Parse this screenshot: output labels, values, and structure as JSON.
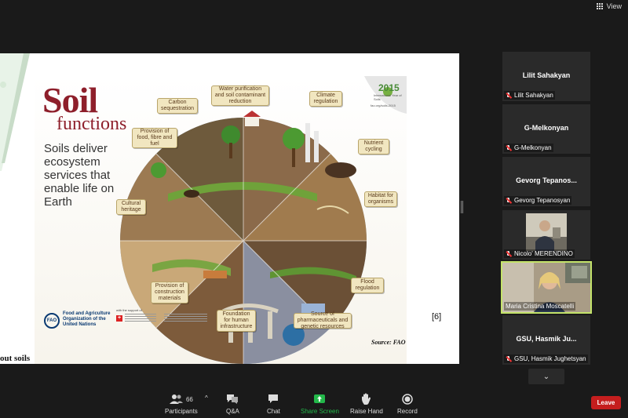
{
  "top_bar": {
    "view_label": "View"
  },
  "slide": {
    "poster": {
      "title": "Soil",
      "subtitle": "functions",
      "tagline": "Soils deliver ecosystem services that enable life on Earth",
      "year": "2015",
      "year_sub": "International Year of Soils",
      "url": "fao.org/soils-2015",
      "labels": [
        "Carbon sequestration",
        "Water purification and soil contaminant reduction",
        "Climate regulation",
        "Nutrient cycling",
        "Provision of food, fibre and fuel",
        "Habitat for organisms",
        "Cultural heritage",
        "Flood regulation",
        "Provision of construction materials",
        "Foundation for human infrastructure",
        "Source of pharmaceuticals and genetic resources"
      ],
      "org_name": "Food and Agriculture Organization of the United Nations",
      "support_text": "with the support of"
    },
    "reference": "[6]",
    "source": "Source: FAO",
    "caption": "out soils"
  },
  "participants": [
    {
      "display_name": "Lilit Sahakyan",
      "tag_name": "Lilit Sahakyan",
      "muted": true,
      "video": false
    },
    {
      "display_name": "G-Melkonyan",
      "tag_name": "G-Melkonyan",
      "muted": true,
      "video": false
    },
    {
      "display_name": "Gevorg Tepanos...",
      "tag_name": "Gevorg Tepanosyan",
      "muted": true,
      "video": false
    },
    {
      "display_name": "",
      "tag_name": "Nicolo' MERENDINO",
      "muted": true,
      "video": true
    },
    {
      "display_name": "",
      "tag_name": "Maria Cristina Moscatelli",
      "muted": false,
      "video": true,
      "active": true
    },
    {
      "display_name": "GSU, Hasmik Ju...",
      "tag_name": "GSU, Hasmik Jughetsyan",
      "muted": true,
      "video": false
    }
  ],
  "toolbar": {
    "participants_label": "Participants",
    "participants_count": "66",
    "qa_label": "Q&A",
    "chat_label": "Chat",
    "share_label": "Share Screen",
    "raise_label": "Raise Hand",
    "record_label": "Record",
    "leave_label": "Leave"
  },
  "colors": {
    "background": "#1a1a1a",
    "share_green": "#23b84a",
    "leave_red": "#c51e1e",
    "active_speaker": "#c4e36a",
    "poster_title": "#8e1f2b"
  }
}
